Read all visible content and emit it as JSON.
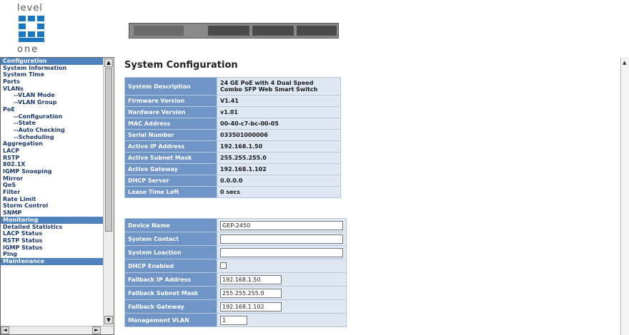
{
  "header": {
    "logo_top": "level",
    "logo_bottom": "one"
  },
  "menu": {
    "items": [
      {
        "label": "Configuration",
        "type": "section"
      },
      {
        "label": "System Information",
        "type": "item"
      },
      {
        "label": "System Time",
        "type": "item"
      },
      {
        "label": "Ports",
        "type": "item"
      },
      {
        "label": "VLANs",
        "type": "item"
      },
      {
        "label": "--VLAN Mode",
        "type": "sub"
      },
      {
        "label": "--VLAN Group",
        "type": "sub"
      },
      {
        "label": "PoE",
        "type": "item"
      },
      {
        "label": "--Configuration",
        "type": "sub"
      },
      {
        "label": "--State",
        "type": "sub"
      },
      {
        "label": "--Auto Checking",
        "type": "sub"
      },
      {
        "label": "--Scheduling",
        "type": "sub"
      },
      {
        "label": "Aggregation",
        "type": "item"
      },
      {
        "label": "LACP",
        "type": "item"
      },
      {
        "label": "RSTP",
        "type": "item"
      },
      {
        "label": "802.1X",
        "type": "item"
      },
      {
        "label": "IGMP Snooping",
        "type": "item"
      },
      {
        "label": "Mirror",
        "type": "item"
      },
      {
        "label": "QoS",
        "type": "item"
      },
      {
        "label": "Filter",
        "type": "item"
      },
      {
        "label": "Rate Limit",
        "type": "item"
      },
      {
        "label": "Storm Control",
        "type": "item"
      },
      {
        "label": "SNMP",
        "type": "item"
      },
      {
        "label": "Monitoring",
        "type": "section"
      },
      {
        "label": "Detailed Statistics",
        "type": "item"
      },
      {
        "label": "LACP Status",
        "type": "item"
      },
      {
        "label": "RSTP Status",
        "type": "item"
      },
      {
        "label": "IGMP Status",
        "type": "item"
      },
      {
        "label": "Ping",
        "type": "item"
      },
      {
        "label": "Maintenance",
        "type": "section"
      }
    ]
  },
  "main": {
    "title": "System Configuration",
    "info": {
      "description_label": "System Description",
      "description_value": "24 GE PoE with 4 Dual Speed Combo SFP Web Smart Switch",
      "firmware_label": "Firmware Version",
      "firmware_value": "V1.41",
      "hardware_label": "Hardware Version",
      "hardware_value": "v1.01",
      "mac_label": "MAC Address",
      "mac_value": "00-40-c7-bc-00-05",
      "serial_label": "Serial Number",
      "serial_value": "033501000006",
      "ip_label": "Active IP Address",
      "ip_value": "192.168.1.50",
      "mask_label": "Active Subnet Mask",
      "mask_value": "255.255.255.0",
      "gateway_label": "Active Gateway",
      "gateway_value": "192.168.1.102",
      "dhcp_server_label": "DHCP Server",
      "dhcp_server_value": "0.0.0.0",
      "lease_label": "Lease Time Left",
      "lease_value": "0 secs"
    },
    "config": {
      "device_name_label": "Device Name",
      "device_name_value": "GEP-2450",
      "contact_label": "System Contact",
      "contact_value": "",
      "location_label": "System Loaction",
      "location_value": "",
      "dhcp_enabled_label": "DHCP Enabled",
      "dhcp_enabled_value": false,
      "fallback_ip_label": "Fallback IP Address",
      "fallback_ip_value": "192.168.1.50",
      "fallback_mask_label": "Fallback Subnet Mask",
      "fallback_mask_value": "255.255.255.0",
      "fallback_gateway_label": "Fallback Gateway",
      "fallback_gateway_value": "192.168.1.102",
      "mgmt_vlan_label": "Management VLAN",
      "mgmt_vlan_value": "1"
    }
  }
}
